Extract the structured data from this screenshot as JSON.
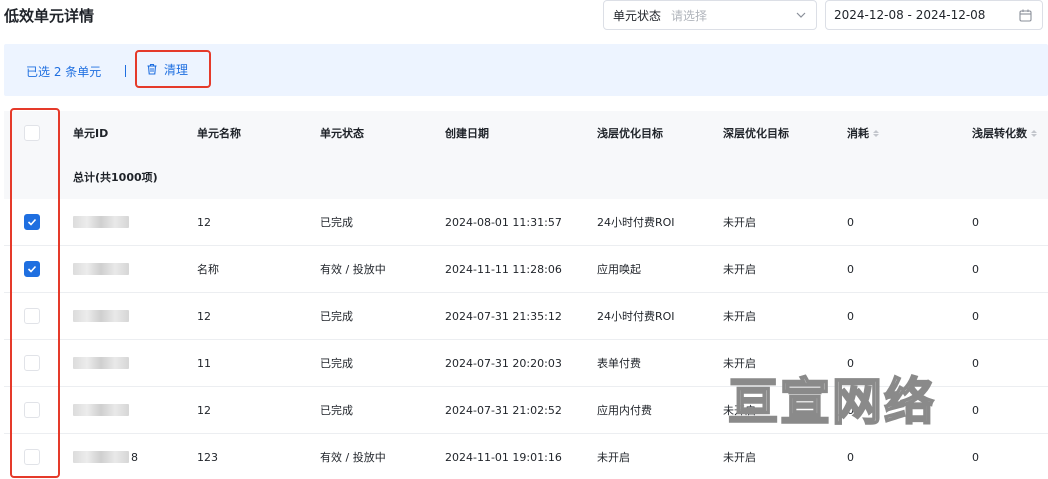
{
  "page": {
    "title": "低效单元详情"
  },
  "filters": {
    "status_label": "单元状态",
    "status_placeholder": "请选择",
    "date_range": "2024-12-08 - 2024-12-08"
  },
  "selection": {
    "count_text": "已选 2 条单元",
    "separator": "|",
    "clear_label": "清理"
  },
  "table": {
    "columns": [
      "单元ID",
      "单元名称",
      "单元状态",
      "创建日期",
      "浅层优化目标",
      "深层优化目标",
      "消耗",
      "浅层转化数"
    ],
    "total_label": "总计(共1000项)",
    "rows": [
      {
        "checked": true,
        "id_tail": "",
        "name": "12",
        "status": "已完成",
        "created": "2024-08-01 11:31:57",
        "shallow_goal": "24小时付费ROI",
        "deep_goal": "未开启",
        "cost": "0",
        "shallow_conv": "0"
      },
      {
        "checked": true,
        "id_tail": "",
        "name": "名称",
        "status": "有效 / 投放中",
        "created": "2024-11-11 11:28:06",
        "shallow_goal": "应用唤起",
        "deep_goal": "未开启",
        "cost": "0",
        "shallow_conv": "0"
      },
      {
        "checked": false,
        "id_tail": "",
        "name": "12",
        "status": "已完成",
        "created": "2024-07-31 21:35:12",
        "shallow_goal": "24小时付费ROI",
        "deep_goal": "未开启",
        "cost": "0",
        "shallow_conv": "0"
      },
      {
        "checked": false,
        "id_tail": "",
        "name": "11",
        "status": "已完成",
        "created": "2024-07-31 20:20:03",
        "shallow_goal": "表单付费",
        "deep_goal": "未开启",
        "cost": "0",
        "shallow_conv": "0"
      },
      {
        "checked": false,
        "id_tail": "",
        "name": "12",
        "status": "已完成",
        "created": "2024-07-31 21:02:52",
        "shallow_goal": "应用内付费",
        "deep_goal": "未开启",
        "cost": "0",
        "shallow_conv": "0"
      },
      {
        "checked": false,
        "id_tail": "8",
        "name": "123",
        "status": "有效 / 投放中",
        "created": "2024-11-01 19:01:16",
        "shallow_goal": "未开启",
        "deep_goal": "未开启",
        "cost": "0",
        "shallow_conv": "0"
      }
    ]
  },
  "watermark": "亘宣网络",
  "colors": {
    "accent": "#1f6fe0",
    "highlight": "#e53a2a",
    "header_bg": "#f7f8fa",
    "selection_bg": "#edf4ff"
  }
}
